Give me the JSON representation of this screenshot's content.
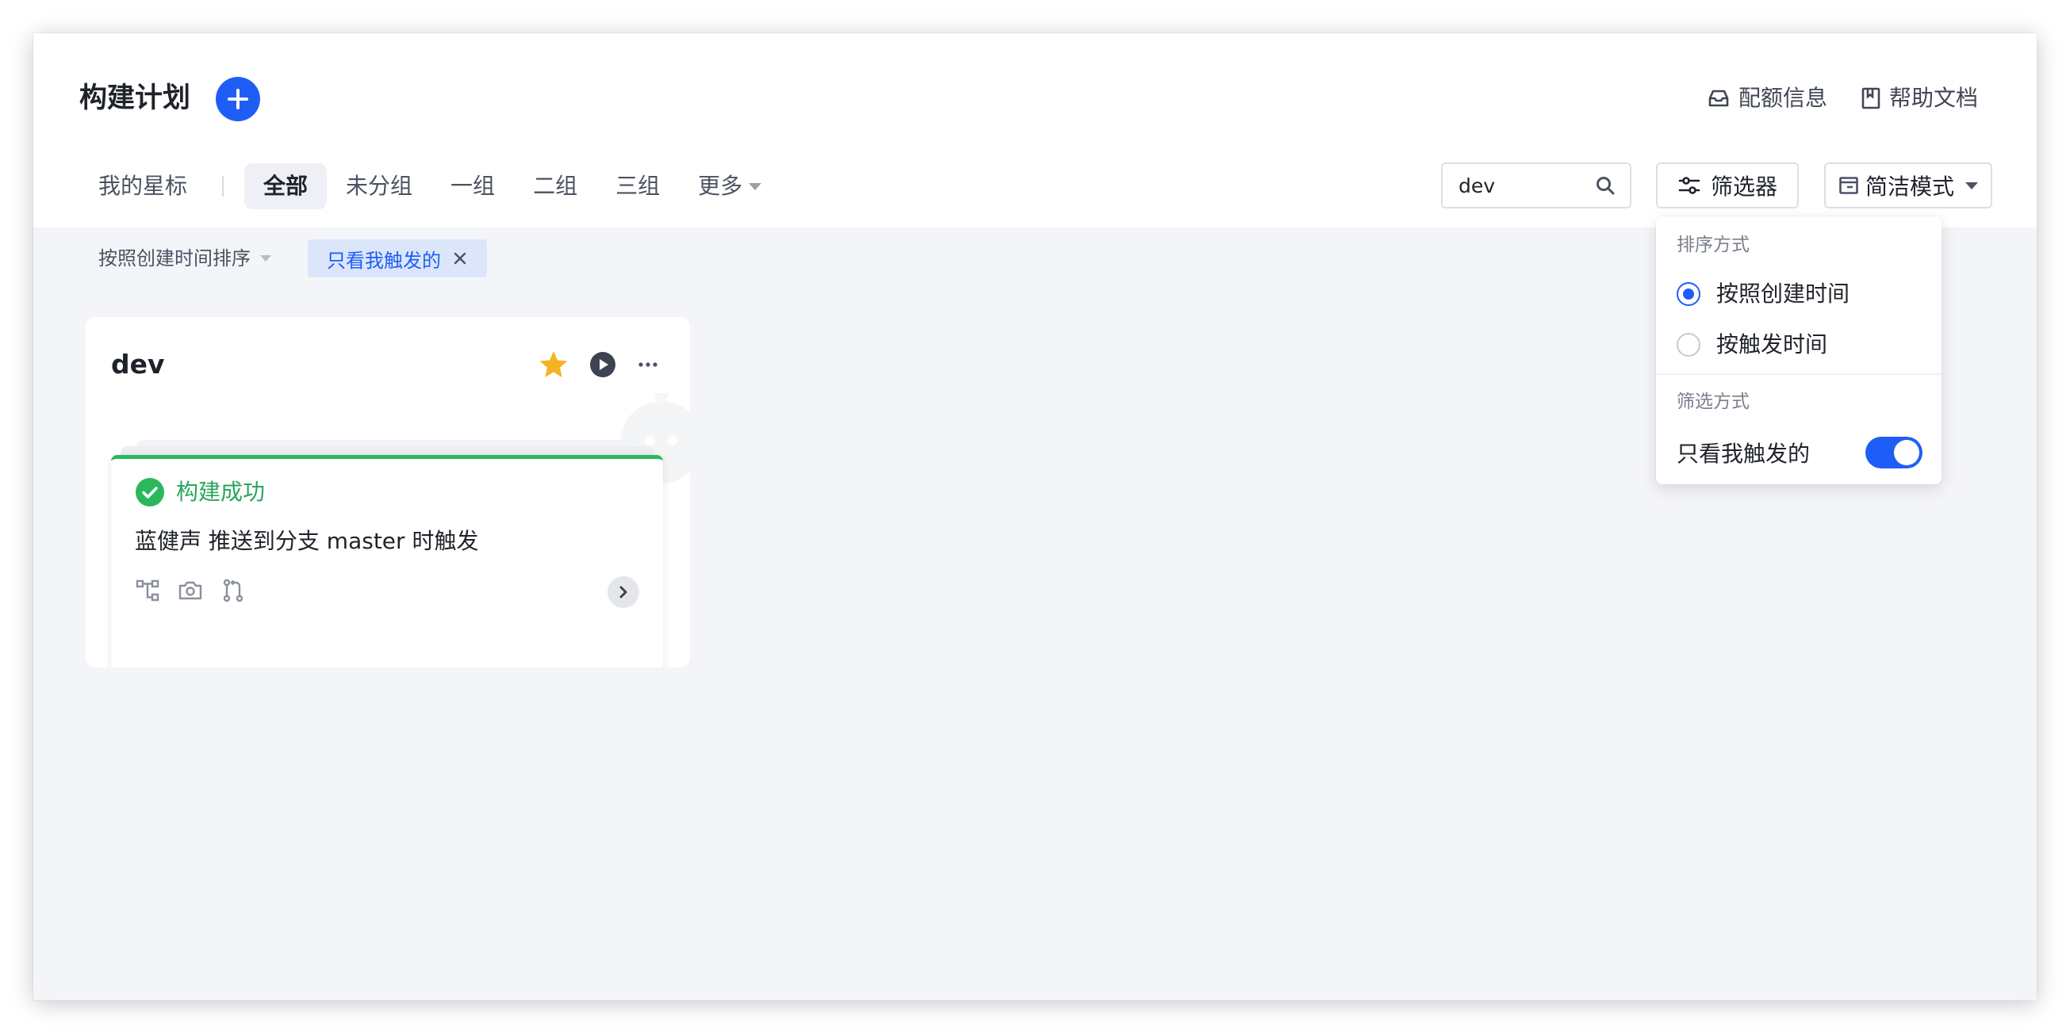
{
  "header": {
    "title": "构建计划",
    "quota_label": "配额信息",
    "help_label": "帮助文档"
  },
  "tabs": [
    {
      "label": "我的星标"
    },
    {
      "label": "全部",
      "active": true
    },
    {
      "label": "未分组"
    },
    {
      "label": "一组"
    },
    {
      "label": "二组"
    },
    {
      "label": "三组"
    },
    {
      "label": "更多"
    }
  ],
  "search": {
    "value": "dev"
  },
  "toolbar": {
    "filter_label": "筛选器",
    "mode_label": "简洁模式"
  },
  "sort": {
    "label": "按照创建时间排序"
  },
  "active_filter": {
    "label": "只看我触发的"
  },
  "card": {
    "title": "dev",
    "build": {
      "status": "构建成功",
      "description": "蓝健声 推送到分支 master 时触发"
    }
  },
  "dropdown": {
    "sort_section": "排序方式",
    "sort_options": [
      {
        "label": "按照创建时间",
        "checked": true
      },
      {
        "label": "按触发时间",
        "checked": false
      }
    ],
    "filter_section": "筛选方式",
    "filter_option": {
      "label": "只看我触发的",
      "enabled": true
    }
  },
  "colors": {
    "accent": "#1f5ef6",
    "success": "#2bb85b",
    "star": "#f5b323"
  }
}
